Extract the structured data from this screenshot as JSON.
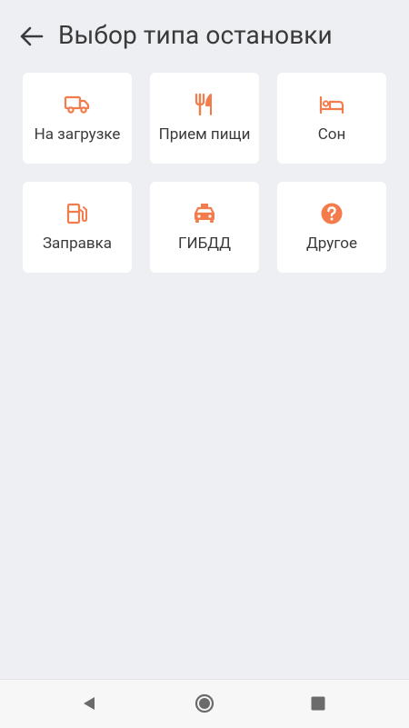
{
  "header": {
    "title": "Выбор типа остановки",
    "back_icon": "arrow-left-icon"
  },
  "accent_color": "#f47c4c",
  "stop_types": [
    {
      "label": "На загрузке",
      "icon": "truck-icon"
    },
    {
      "label": "Прием пищи",
      "icon": "fork-knife-icon"
    },
    {
      "label": "Сон",
      "icon": "bed-icon"
    },
    {
      "label": "Заправка",
      "icon": "fuel-pump-icon"
    },
    {
      "label": "ГИБДД",
      "icon": "taxi-icon"
    },
    {
      "label": "Другое",
      "icon": "question-circle-icon"
    }
  ],
  "navbar": {
    "icons": [
      "back-triangle-icon",
      "home-circle-icon",
      "recents-square-icon"
    ]
  }
}
